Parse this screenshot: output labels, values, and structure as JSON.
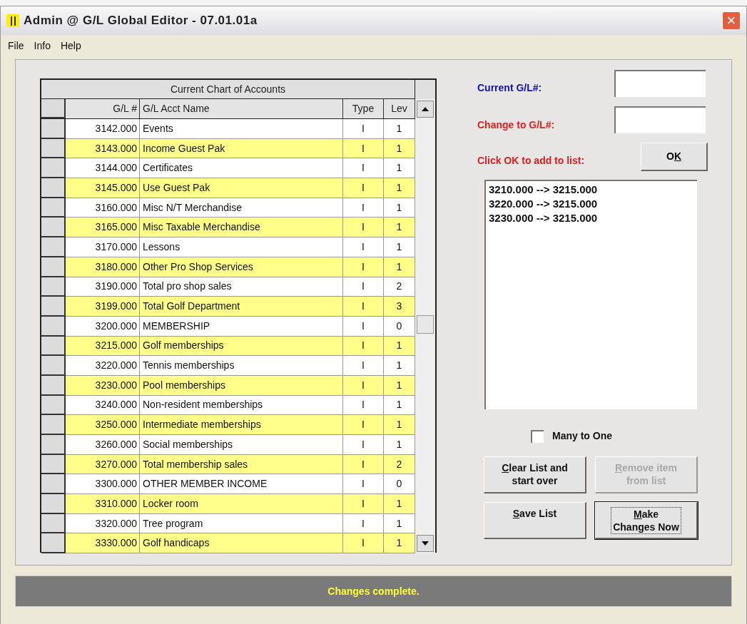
{
  "window": {
    "title": "Admin @ G/L Global Editor - 07.01.01a",
    "close": "×"
  },
  "menu": [
    {
      "label": "File"
    },
    {
      "label": "Info"
    },
    {
      "label": "Help"
    }
  ],
  "grid": {
    "title": "Current Chart of Accounts",
    "columns": [
      "G/L #",
      "G/L Acct Name",
      "Type",
      "Lev"
    ],
    "rows": [
      [
        "3142.000",
        "Events",
        "I",
        "1"
      ],
      [
        "3143.000",
        "Income Guest Pak",
        "I",
        "1"
      ],
      [
        "3144.000",
        "Certificates",
        "I",
        "1"
      ],
      [
        "3145.000",
        "Use Guest Pak",
        "I",
        "1"
      ],
      [
        "3160.000",
        "Misc N/T Merchandise",
        "I",
        "1"
      ],
      [
        "3165.000",
        "Misc Taxable Merchandise",
        "I",
        "1"
      ],
      [
        "3170.000",
        "Lessons",
        "I",
        "1"
      ],
      [
        "3180.000",
        "Other Pro Shop Services",
        "I",
        "1"
      ],
      [
        "3190.000",
        "Total pro shop sales",
        "I",
        "2"
      ],
      [
        "3199.000",
        "Total Golf Department",
        "I",
        "3"
      ],
      [
        "3200.000",
        "MEMBERSHIP",
        "I",
        "0"
      ],
      [
        "3215.000",
        "Golf memberships",
        "I",
        "1"
      ],
      [
        "3220.000",
        "Tennis memberships",
        "I",
        "1"
      ],
      [
        "3230.000",
        "Pool memberships",
        "I",
        "1"
      ],
      [
        "3240.000",
        "Non-resident memberships",
        "I",
        "1"
      ],
      [
        "3250.000",
        "Intermediate memberships",
        "I",
        "1"
      ],
      [
        "3260.000",
        "Social memberships",
        "I",
        "1"
      ],
      [
        "3270.000",
        "Total membership sales",
        "I",
        "2"
      ],
      [
        "3300.000",
        "OTHER MEMBER INCOME",
        "I",
        "0"
      ],
      [
        "3310.000",
        "Locker room",
        "I",
        "1"
      ],
      [
        "3320.000",
        "Tree program",
        "I",
        "1"
      ],
      [
        "3330.000",
        "Golf handicaps",
        "I",
        "1"
      ]
    ]
  },
  "current_gl": {
    "label": "Current G/L#:",
    "color": "#1010c0"
  },
  "change_to_gl": {
    "label": "Change to G/L#:",
    "color": "#e02020"
  },
  "ok_prompt": {
    "label": "Click OK to add to list:",
    "color": "#e02020"
  },
  "ok_button": {
    "before": "O",
    "key": "K"
  },
  "change_list": [
    "3210.000 --> 3215.000",
    "3220.000 --> 3215.000",
    "3230.000 --> 3215.000"
  ],
  "many_to_one": {
    "label": "Many to One",
    "checked": false
  },
  "buttons": [
    {
      "key": "C",
      "after": "lear List and\nstart over",
      "disabled": false,
      "focused": false
    },
    {
      "key": "R",
      "after": "emove item\nfrom list",
      "disabled": true,
      "focused": false
    },
    {
      "key": "S",
      "after": "ave List",
      "disabled": false,
      "focused": false
    },
    {
      "key": "M",
      "after": "ake\nChanges Now",
      "disabled": false,
      "focused": true
    }
  ],
  "status_bar": "Changes complete."
}
